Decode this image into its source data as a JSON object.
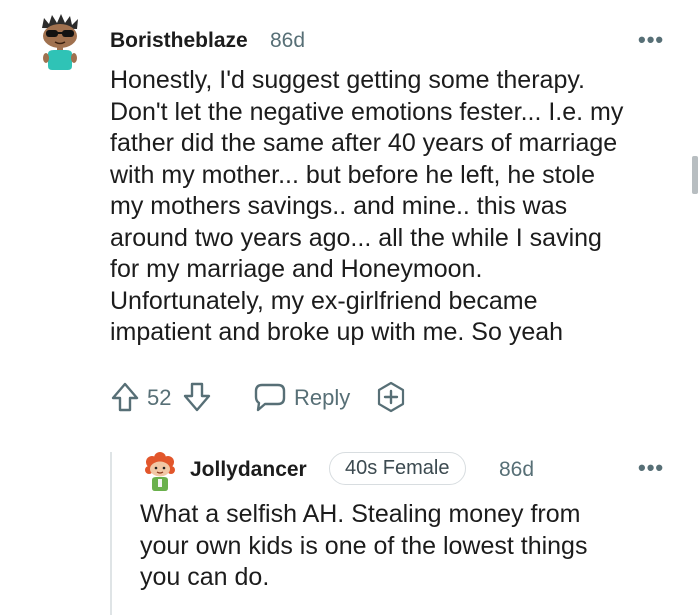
{
  "comment": {
    "author": "Boristheblaze",
    "age": "86d",
    "more": "•••",
    "lines": [
      "Honestly, I'd suggest getting some therapy.",
      "Don't let the negative emotions fester... I.e. my",
      "father did the same after 40 years of marriage",
      "with my mother... but before he left, he stole",
      "my mothers savings.. and mine.. this was",
      "around two years ago... all the while I saving",
      "for my marriage and Honeymoon.",
      "Unfortunately, my ex-girlfriend became",
      "impatient and broke up with me. So yeah"
    ],
    "vote_count": "52",
    "reply_label": "Reply",
    "icons": {
      "upvote": "upvote-arrow-icon",
      "downvote": "downvote-arrow-icon",
      "reply": "speech-bubble-icon",
      "award": "plus-circle-icon",
      "more": "ellipsis-icon"
    }
  },
  "reply": {
    "author": "Jollydancer",
    "flair": "40s Female",
    "age": "86d",
    "more": "•••",
    "lines": [
      "What a selfish AH. Stealing money from",
      "your own kids is one of the lowest things",
      "you can do."
    ]
  },
  "colors": {
    "text": "#1c1c1c",
    "meta": "#576f76",
    "flair_border": "#d8dde0",
    "thread_line": "#dfe4e6"
  }
}
